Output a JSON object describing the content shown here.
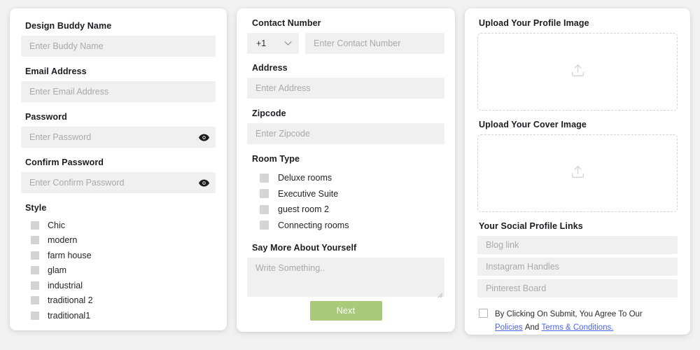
{
  "theme": {
    "page_background": "#f2f2f2",
    "card_background": "#ffffff",
    "input_background": "#f0f0f0",
    "label_color": "#1c1c22",
    "placeholder_color": "#a9a9a9",
    "accent_button": "#a9ca7a",
    "link_color": "#4a63e7",
    "checkbox_fill": "#d3d3d3",
    "dashed_border": "#d2d2d2"
  },
  "left_panel": {
    "buddy_name": {
      "label": "Design Buddy Name",
      "placeholder": "Enter Buddy Name",
      "value": ""
    },
    "email": {
      "label": "Email Address",
      "placeholder": "Enter Email Address",
      "value": ""
    },
    "password": {
      "label": "Password",
      "placeholder": "Enter Password",
      "value": ""
    },
    "confirm_password": {
      "label": "Confirm Password",
      "placeholder": "Enter Confirm Password",
      "value": ""
    },
    "style": {
      "label": "Style",
      "options": [
        {
          "label": "Chic",
          "checked": false
        },
        {
          "label": "modern",
          "checked": false
        },
        {
          "label": "farm house",
          "checked": false
        },
        {
          "label": "glam",
          "checked": false
        },
        {
          "label": "industrial",
          "checked": false
        },
        {
          "label": "traditional 2",
          "checked": false
        },
        {
          "label": "traditional1",
          "checked": false
        }
      ]
    }
  },
  "middle_panel": {
    "contact_number": {
      "label": "Contact Number",
      "country_code": "+1",
      "placeholder": "Enter Contact Number",
      "value": ""
    },
    "address": {
      "label": "Address",
      "placeholder": "Enter Address",
      "value": ""
    },
    "zipcode": {
      "label": "Zipcode",
      "placeholder": "Enter Zipcode",
      "value": ""
    },
    "room_type": {
      "label": "Room Type",
      "options": [
        {
          "label": "Deluxe rooms",
          "checked": false
        },
        {
          "label": "Executive Suite",
          "checked": false
        },
        {
          "label": "guest room 2",
          "checked": false
        },
        {
          "label": "Connecting rooms",
          "checked": false
        }
      ]
    },
    "about": {
      "label": "Say More About Yourself",
      "placeholder": "Write Something..",
      "value": ""
    },
    "next_button": "Next"
  },
  "right_panel": {
    "profile_image": {
      "label": "Upload Your Profile Image",
      "icon": "upload-icon"
    },
    "cover_image": {
      "label": "Upload Your Cover Image",
      "icon": "upload-icon"
    },
    "social": {
      "label": "Your Social Profile Links",
      "fields": [
        {
          "placeholder": "Blog link",
          "value": ""
        },
        {
          "placeholder": "Instagram Handles",
          "value": ""
        },
        {
          "placeholder": "Pinterest Board",
          "value": ""
        }
      ]
    },
    "terms": {
      "checked": false,
      "line1": "By Clicking On Submit, You Agree To Our",
      "link1": "Policies",
      "conjunction": "And",
      "link2": "Terms & Conditions."
    }
  }
}
